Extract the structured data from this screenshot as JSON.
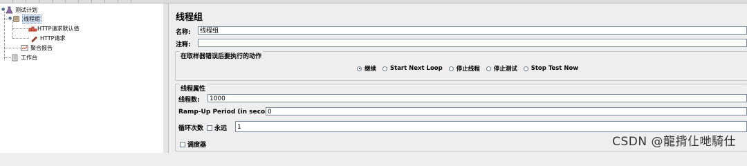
{
  "tree": {
    "test_plan": "测试计划",
    "thread_group": "线程组",
    "http_defaults": "HTTP请求默认值",
    "http_request": "HTTP请求",
    "aggregate_report": "聚合报告",
    "workbench": "工作台"
  },
  "main": {
    "title": "线程组",
    "name_label": "名称:",
    "name_value": "线程组",
    "comment_label": "注释:",
    "comment_value": "",
    "error_group": {
      "title": "在取样器错误后要执行的动作",
      "options": [
        "继续",
        "Start Next Loop",
        "停止线程",
        "停止测试",
        "Stop Test Now"
      ],
      "selected": "继续"
    },
    "thread_props": {
      "title": "线程属性",
      "threads_label": "线程数:",
      "threads_value": "1000",
      "rampup_label": "Ramp-Up Period (in seconds):",
      "rampup_value": "0",
      "loop_label": "循环次数",
      "forever_label": "永远",
      "forever_checked": false,
      "loop_value": "1",
      "scheduler_label": "调度器",
      "scheduler_checked": false
    }
  },
  "watermark": "CSDN @龍揹仩哋騎仕"
}
